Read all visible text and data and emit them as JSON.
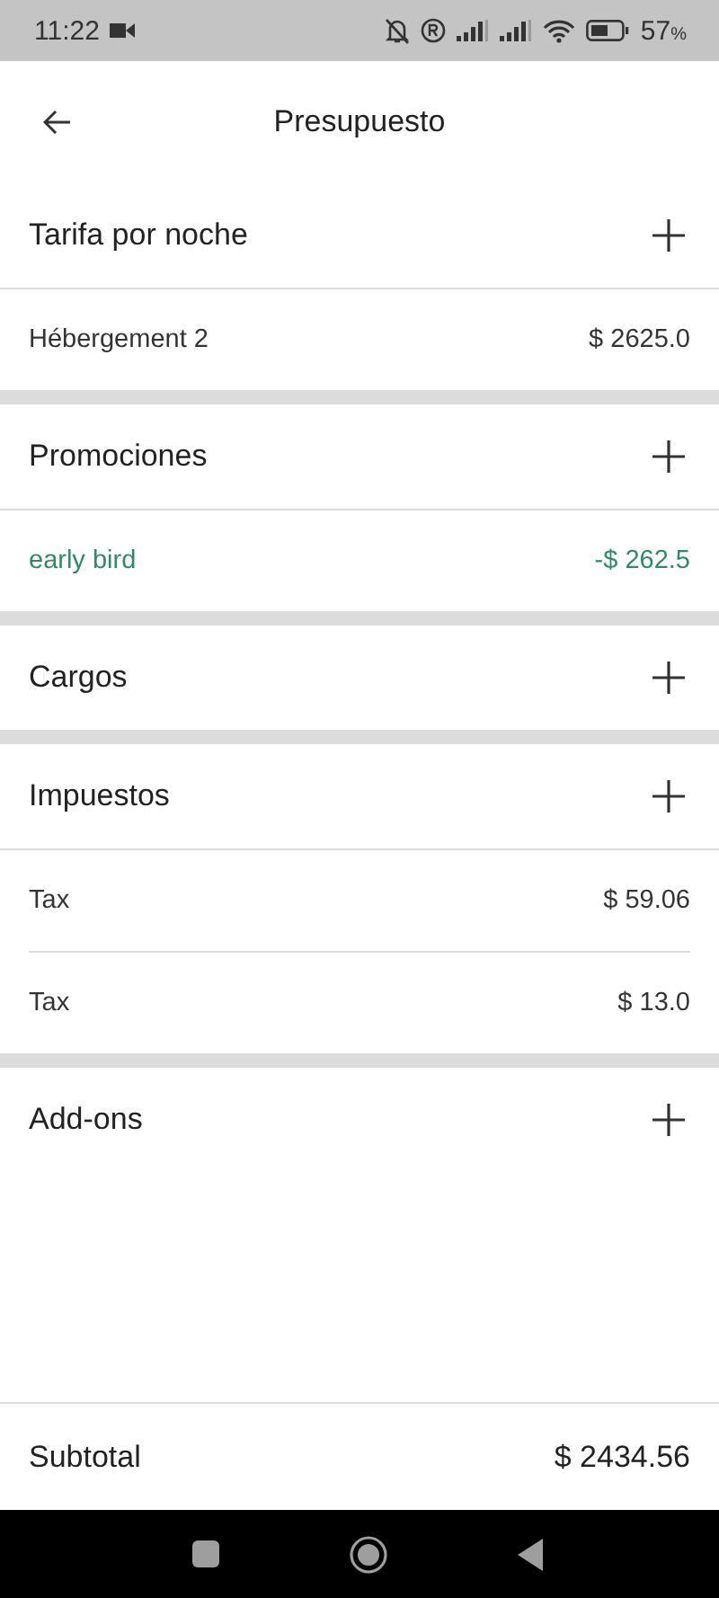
{
  "status_bar": {
    "time": "11:22",
    "battery": "57",
    "battery_unit": "%"
  },
  "header": {
    "title": "Presupuesto"
  },
  "sections": [
    {
      "title": "Tarifa por noche",
      "items": [
        {
          "label": "Hébergement 2",
          "amount": "$ 2625.0",
          "kind": "charge"
        }
      ]
    },
    {
      "title": "Promociones",
      "items": [
        {
          "label": "early bird",
          "amount": "-$ 262.5",
          "kind": "discount"
        }
      ]
    },
    {
      "title": "Cargos"
    },
    {
      "title": "Impuestos",
      "items": [
        {
          "label": "Tax",
          "amount": "$ 59.06",
          "kind": "charge"
        },
        {
          "label": "Tax",
          "amount": "$ 13.0",
          "kind": "charge"
        }
      ]
    },
    {
      "title": "Add-ons"
    }
  ],
  "footer": {
    "label": "Subtotal",
    "amount": "$ 2434.56"
  }
}
